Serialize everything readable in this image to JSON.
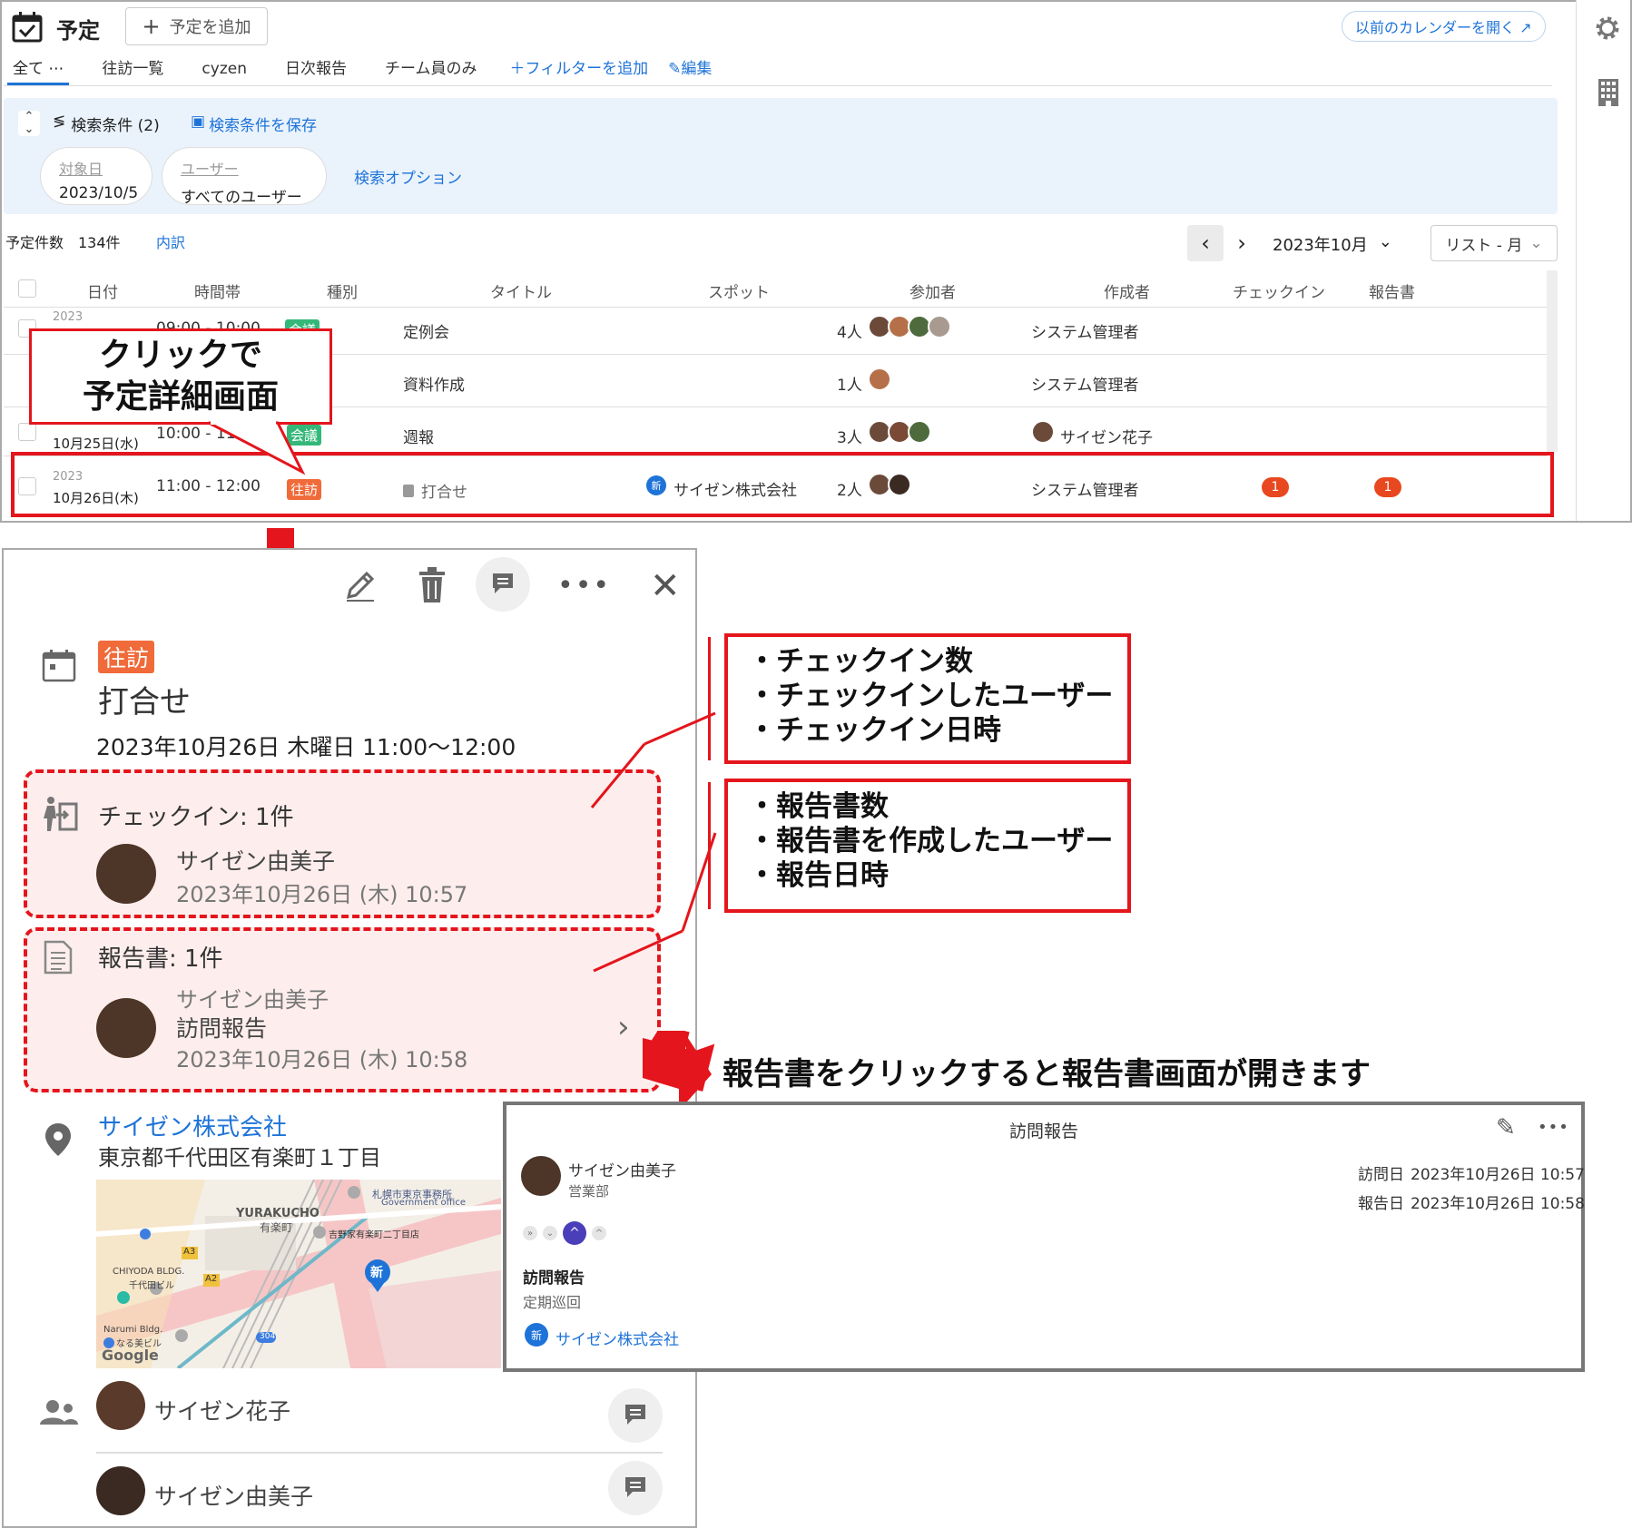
{
  "header": {
    "title": "予定",
    "add_label": "予定を追加",
    "old_calendar_label": "以前のカレンダーを開く ↗"
  },
  "tabs": {
    "items": [
      "全て ⋯",
      "往訪一覧",
      "cyzen",
      "日次報告",
      "チーム員のみ"
    ],
    "add_filter": "＋フィルターを追加",
    "edit": "編集"
  },
  "search": {
    "toggle_label": "検索条件 (2)",
    "save_label": "検索条件を保存",
    "chip_date_label": "対象日",
    "chip_date_value": "2023/10/5",
    "chip_user_label": "ユーザー",
    "chip_user_value": "すべてのユーザー",
    "options_label": "検索オプション"
  },
  "summary": {
    "count_label": "予定件数",
    "count_value": "134件",
    "breakdown_label": "内訳",
    "month": "2023年10月",
    "view": "リスト - 月"
  },
  "table": {
    "columns": [
      "日付",
      "時間帯",
      "種別",
      "タイトル",
      "スポット",
      "参加者",
      "作成者",
      "チェックイン",
      "報告書"
    ],
    "rows": [
      {
        "year": "2023",
        "day": "",
        "time": "09:00 - 10:00",
        "type": "会議",
        "title": "定例会",
        "spot": "",
        "participants": "4人",
        "creator": "システム管理者",
        "checkin": "",
        "report": ""
      },
      {
        "year": "",
        "day": "",
        "time": "",
        "type": "",
        "title": "資料作成",
        "spot": "",
        "participants": "1人",
        "creator": "システム管理者",
        "checkin": "",
        "report": ""
      },
      {
        "year": "2023",
        "day": "10月25日(水)",
        "time": "10:00 - 11:00",
        "type": "会議",
        "title": "週報",
        "spot": "",
        "participants": "3人",
        "creator": "サイゼン花子",
        "checkin": "",
        "report": ""
      },
      {
        "year": "2023",
        "day": "10月26日(木)",
        "time": "11:00 - 12:00",
        "type": "往訪",
        "title": "打合せ",
        "spot": "サイゼン株式会社",
        "participants": "2人",
        "creator": "システム管理者",
        "checkin": "1",
        "report": "1"
      }
    ]
  },
  "callout_click": [
    "クリックで",
    "予定詳細画面"
  ],
  "detail": {
    "type_badge": "往訪",
    "title": "打合せ",
    "datetime": "2023年10月26日 木曜日 11:00〜12:00",
    "checkin_title": "チェックイン: 1件",
    "checkin_user": "サイゼン由美子",
    "checkin_time": "2023年10月26日 (木) 10:57",
    "report_title": "報告書: 1件",
    "report_user": "サイゼン由美子",
    "report_name": "訪問報告",
    "report_time": "2023年10月26日 (木) 10:58",
    "spot_name": "サイゼン株式会社",
    "spot_address": "東京都千代田区有楽町１丁目",
    "participants": [
      "サイゼン花子",
      "サイゼン由美子"
    ]
  },
  "map": {
    "labels": [
      "札幌市東京事務所",
      "Government office",
      "YURAKUCHO",
      "有楽町",
      "吉野家有楽町二丁目店",
      "CHIYODA BLDG.",
      "千代田ビル",
      "A3",
      "A2",
      "Narumi Bldg.",
      "なる美ビル",
      "304",
      "Google",
      "新"
    ]
  },
  "info_checkin": [
    "・チェックイン数",
    "・チェックインしたユーザー",
    "・チェックイン日時"
  ],
  "info_report": [
    "・報告書数",
    "・報告書を作成したユーザー",
    "・報告日時"
  ],
  "caption_report": "報告書をクリックすると報告書画面が開きます",
  "report_panel": {
    "title": "訪問報告",
    "user": "サイゼン由美子",
    "department": "営業部",
    "visit_label": "訪問日",
    "visit_value": "2023年10月26日 10:57",
    "report_label": "報告日",
    "report_value": "2023年10月26日 10:58",
    "section_title": "訪問報告",
    "section_value": "定期巡回",
    "spot": "サイゼン株式会社",
    "spot_badge": "新"
  },
  "colors": {
    "accent": "#1e73d8",
    "annotation_red": "#e4151c",
    "badge_meeting": "#34b87a",
    "badge_visit": "#f06a3a"
  }
}
